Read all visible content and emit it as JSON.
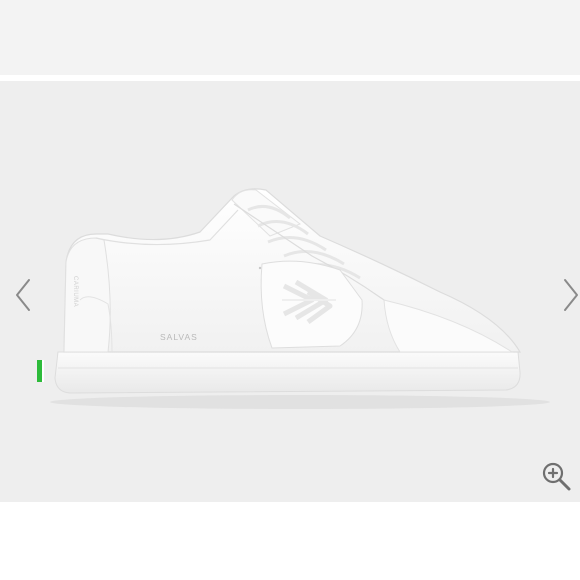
{
  "product": {
    "side_label": "SALVAS",
    "heel_label": "CARIUMA",
    "primary_color": "#ffffff",
    "outsole_tag_color": "#2dbb3a",
    "gallery_background": "#eeeeee"
  },
  "gallery": {
    "prev_icon": "chevron-left-icon",
    "next_icon": "chevron-right-icon",
    "zoom_icon": "zoom-in-icon"
  }
}
